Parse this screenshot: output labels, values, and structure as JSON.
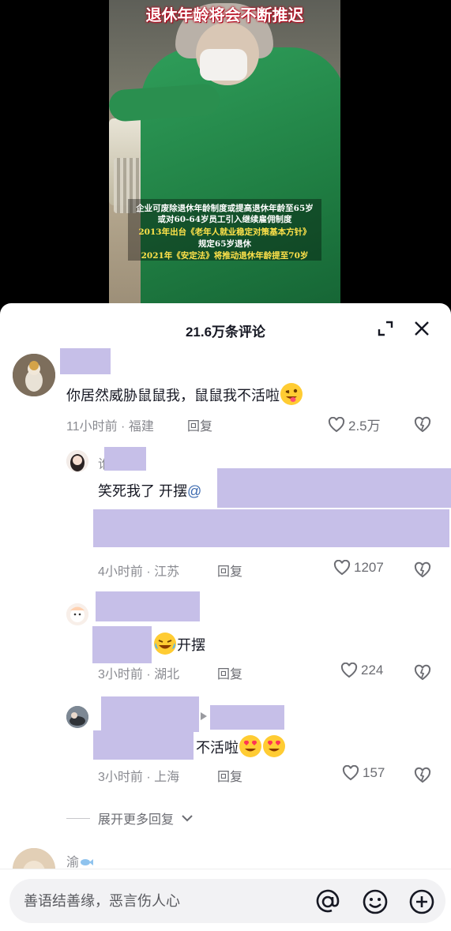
{
  "video": {
    "title_caption": "退休年龄将会不断推迟",
    "captions": [
      {
        "text": "企业可废除退休年龄制度或提高退休年龄至65岁",
        "color": "white"
      },
      {
        "text": "或对60-64岁员工引入继续雇佣制度",
        "color": "white"
      },
      {
        "text": "2013年出台《老年人就业稳定对策基本方针》",
        "color": "yellow"
      },
      {
        "text": "规定65岁退休",
        "color": "white"
      },
      {
        "text": "2021年《安定法》将推动退休年龄提至70岁",
        "color": "yellow"
      }
    ]
  },
  "comments_header": {
    "title": "21.6万条评论",
    "expand_icon": "expand-icon",
    "close_icon": "close-icon"
  },
  "comments": {
    "top": {
      "text": "你居然威胁鼠鼠我，鼠鼠我不活啦",
      "emoji": "winking-face-with-tongue",
      "time": "11小时前 · 福建",
      "reply_label": "回复",
      "likes": "2.5万"
    },
    "replies": [
      {
        "username_prefix": "谁",
        "text": "笑死我了 开摆",
        "mention_symbol": "@",
        "time": "4小时前 · 江苏",
        "reply_label": "回复",
        "likes": "1207"
      },
      {
        "text": "开摆",
        "emoji": "laughing-tears-face",
        "time": "3小时前 · 湖北",
        "reply_label": "回复",
        "likes": "224"
      },
      {
        "text": "不活啦",
        "emoji": "heart-eyes-face",
        "time": "3小时前 · 上海",
        "reply_label": "回复",
        "likes": "157"
      }
    ],
    "expand_label": "展开更多回复",
    "next_username": "渝"
  },
  "input_bar": {
    "placeholder": "善语结善缘，恶言伤人心",
    "icons": [
      "at-icon",
      "emoji-icon",
      "add-icon"
    ]
  }
}
